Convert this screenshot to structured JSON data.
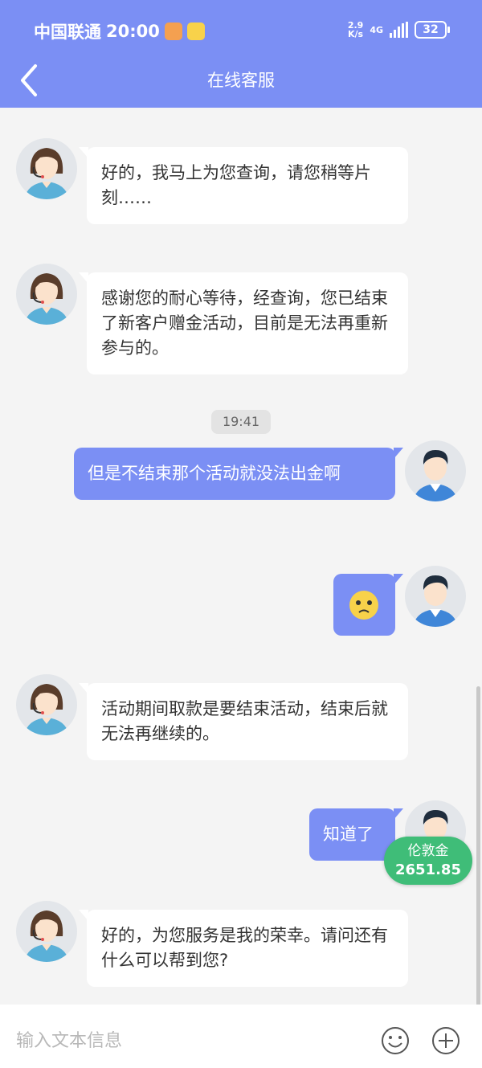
{
  "status_bar": {
    "carrier": "中国联通",
    "time": "20:00",
    "speed_top": "2.9",
    "speed_bottom": "K/s",
    "network": "4G",
    "battery": "32"
  },
  "header": {
    "title": "在线客服",
    "back_icon": "chevron-left-icon"
  },
  "messages": [
    {
      "from": "agent",
      "text": "好的，我马上为您查询，请您稍等片刻……"
    },
    {
      "from": "agent",
      "text": "感谢您的耐心等待，经查询，您已结束了新客户赠金活动，目前是无法再重新参与的。"
    },
    {
      "type": "time",
      "text": "19:41"
    },
    {
      "from": "user",
      "text": "但是不结束那个活动就没法出金啊"
    },
    {
      "from": "user",
      "emoji": "worried-face-icon"
    },
    {
      "from": "agent",
      "text": "活动期间取款是要结束活动，结束后就无法再继续的。"
    },
    {
      "from": "user",
      "text": "知道了"
    },
    {
      "from": "agent",
      "text": "好的，为您服务是我的荣幸。请问还有什么可以帮到您?"
    }
  ],
  "balance_badge": {
    "label": "伦敦金",
    "value": "2651.85",
    "color": "#3fbd78"
  },
  "input_bar": {
    "placeholder": "输入文本信息",
    "emoji_icon": "smiley-icon",
    "plus_icon": "plus-circle-icon"
  },
  "colors": {
    "primary": "#7b8ff4",
    "background": "#f4f4f4",
    "bubble_incoming": "#ffffff"
  }
}
